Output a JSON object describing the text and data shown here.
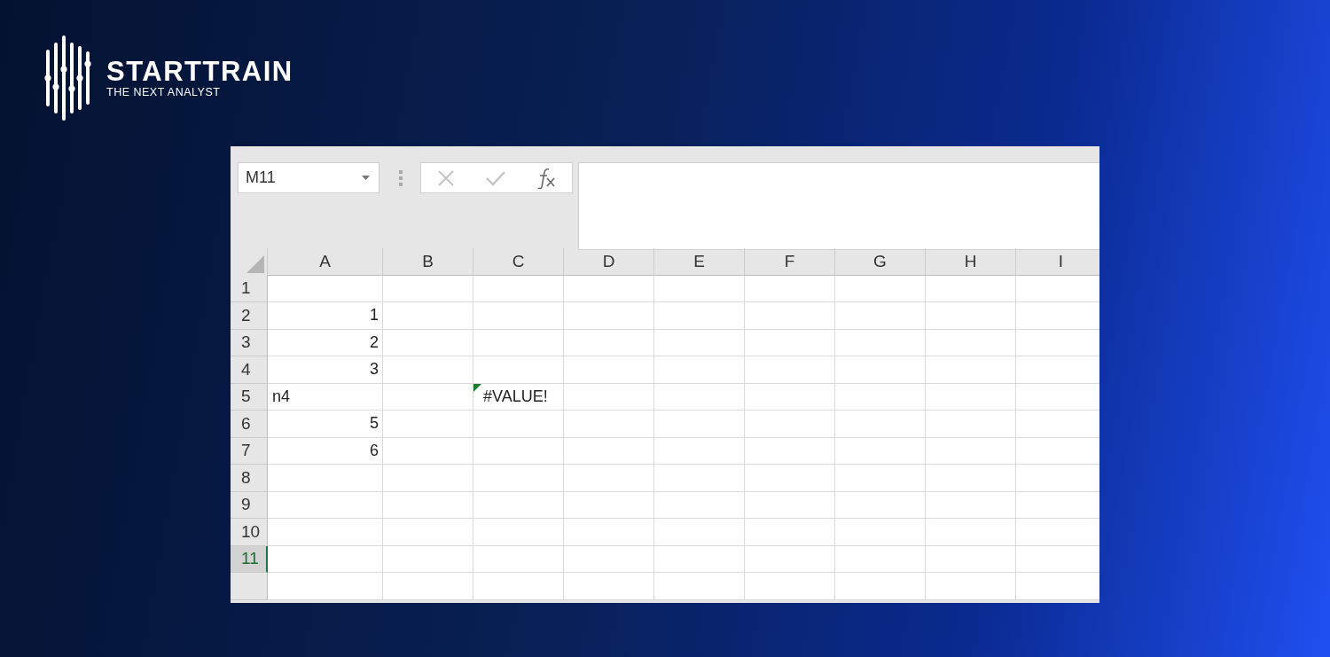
{
  "brand": {
    "name": "STARTTRAIN",
    "tagline": "THE NEXT ANALYST"
  },
  "name_box": {
    "value": "M11"
  },
  "columns": [
    "A",
    "B",
    "C",
    "D",
    "E",
    "F",
    "G",
    "H",
    "I"
  ],
  "rows": [
    {
      "label": "1",
      "selected": false,
      "cells": []
    },
    {
      "label": "2",
      "selected": false,
      "cells": [
        {
          "kind": "number",
          "text": "1"
        }
      ]
    },
    {
      "label": "3",
      "selected": false,
      "cells": [
        {
          "kind": "number",
          "text": "2"
        }
      ]
    },
    {
      "label": "4",
      "selected": false,
      "cells": [
        {
          "kind": "number",
          "text": "3"
        }
      ]
    },
    {
      "label": "5",
      "selected": false,
      "cells": [
        {
          "kind": "text",
          "text": "n4"
        },
        {
          "kind": "empty"
        },
        {
          "kind": "error",
          "text": "#VALUE!"
        }
      ]
    },
    {
      "label": "6",
      "selected": false,
      "cells": [
        {
          "kind": "number",
          "text": "5"
        }
      ]
    },
    {
      "label": "7",
      "selected": false,
      "cells": [
        {
          "kind": "number",
          "text": "6"
        }
      ]
    },
    {
      "label": "8",
      "selected": false,
      "cells": []
    },
    {
      "label": "9",
      "selected": false,
      "cells": []
    },
    {
      "label": "10",
      "selected": false,
      "cells": []
    },
    {
      "label": "11",
      "selected": true,
      "cells": []
    },
    {
      "selected": false,
      "cells": []
    }
  ]
}
